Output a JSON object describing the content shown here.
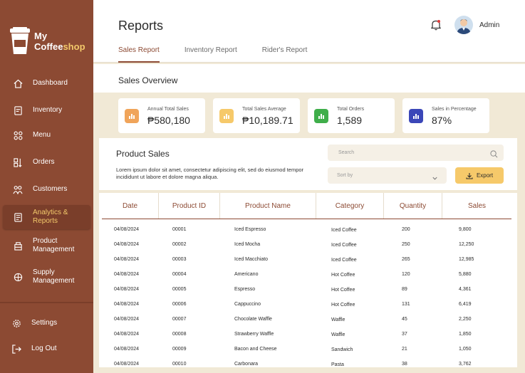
{
  "brand": {
    "line1": "My",
    "line2_a": "Coffee",
    "line2_b": "shop"
  },
  "sidebar": {
    "items": [
      {
        "label": "Dashboard",
        "icon": "home-icon"
      },
      {
        "label": "Inventory",
        "icon": "inventory-icon"
      },
      {
        "label": "Menu",
        "icon": "menu-grid-icon"
      },
      {
        "label": "Orders",
        "icon": "orders-icon"
      },
      {
        "label": "Customers",
        "icon": "customers-icon"
      },
      {
        "label": "Analytics & Reports",
        "icon": "reports-icon",
        "active": true
      },
      {
        "label": "Product Management",
        "icon": "product-icon"
      },
      {
        "label": "Supply Management",
        "icon": "supply-icon"
      }
    ],
    "bottom": [
      {
        "label": "Settings",
        "icon": "gear-icon"
      },
      {
        "label": "Log Out",
        "icon": "logout-icon"
      }
    ]
  },
  "header": {
    "title": "Reports",
    "tabs": [
      "Sales Report",
      "Inventory Report",
      "Rider's Report"
    ],
    "user": "Admin"
  },
  "overview": {
    "title": "Sales Overview",
    "cards": [
      {
        "label": "Annual Total Sales",
        "value": "₱580,180",
        "color": "#f0a45a"
      },
      {
        "label": "Total Sales Average",
        "value": "₱10,189.71",
        "color": "#f6c96a"
      },
      {
        "label": "Total Orders",
        "value": "1,589",
        "color": "#3fae4a"
      },
      {
        "label": "Sales in Percentage",
        "value": "87%",
        "color": "#3b47b8"
      }
    ]
  },
  "product_sales": {
    "title": "Product Sales",
    "description": "Lorem ipsum dolor sit amet, consectetur adipiscing elit, sed do eiusmod tempor incididunt ut labore et dolore magna aliqua.",
    "search_placeholder": "Search",
    "sort_placeholder": "Sort by",
    "export_label": "Export"
  },
  "table": {
    "columns": [
      "Date",
      "Product ID",
      "Product Name",
      "Category",
      "Quantity",
      "Sales"
    ],
    "rows": [
      [
        "04/08/2024",
        "00001",
        "Iced Espresso",
        "Iced Coffee",
        "200",
        "9,800"
      ],
      [
        "04/08/2024",
        "00002",
        "Iced Mocha",
        "Iced Coffee",
        "250",
        "12,250"
      ],
      [
        "04/08/2024",
        "00003",
        "Iced Macchiato",
        "Iced Coffee",
        "265",
        "12,985"
      ],
      [
        "04/08/2024",
        "00004",
        "Americano",
        "Hot Coffee",
        "120",
        "5,880"
      ],
      [
        "04/08/2024",
        "00005",
        "Espresso",
        "Hot Coffee",
        "89",
        "4,361"
      ],
      [
        "04/08/2024",
        "00006",
        "Cappuccino",
        "Hot Coffee",
        "131",
        "6,419"
      ],
      [
        "04/08/2024",
        "00007",
        "Chocolate Waffle",
        "Waffle",
        "45",
        "2,250"
      ],
      [
        "04/08/2024",
        "00008",
        "Strawberry Waffle",
        "Waffle",
        "37",
        "1,850"
      ],
      [
        "04/08/2024",
        "00009",
        "Bacon and Cheese",
        "Sandwich",
        "21",
        "1,050"
      ],
      [
        "04/08/2024",
        "00010",
        "Carbonara",
        "Pasta",
        "38",
        "3,762"
      ]
    ]
  }
}
